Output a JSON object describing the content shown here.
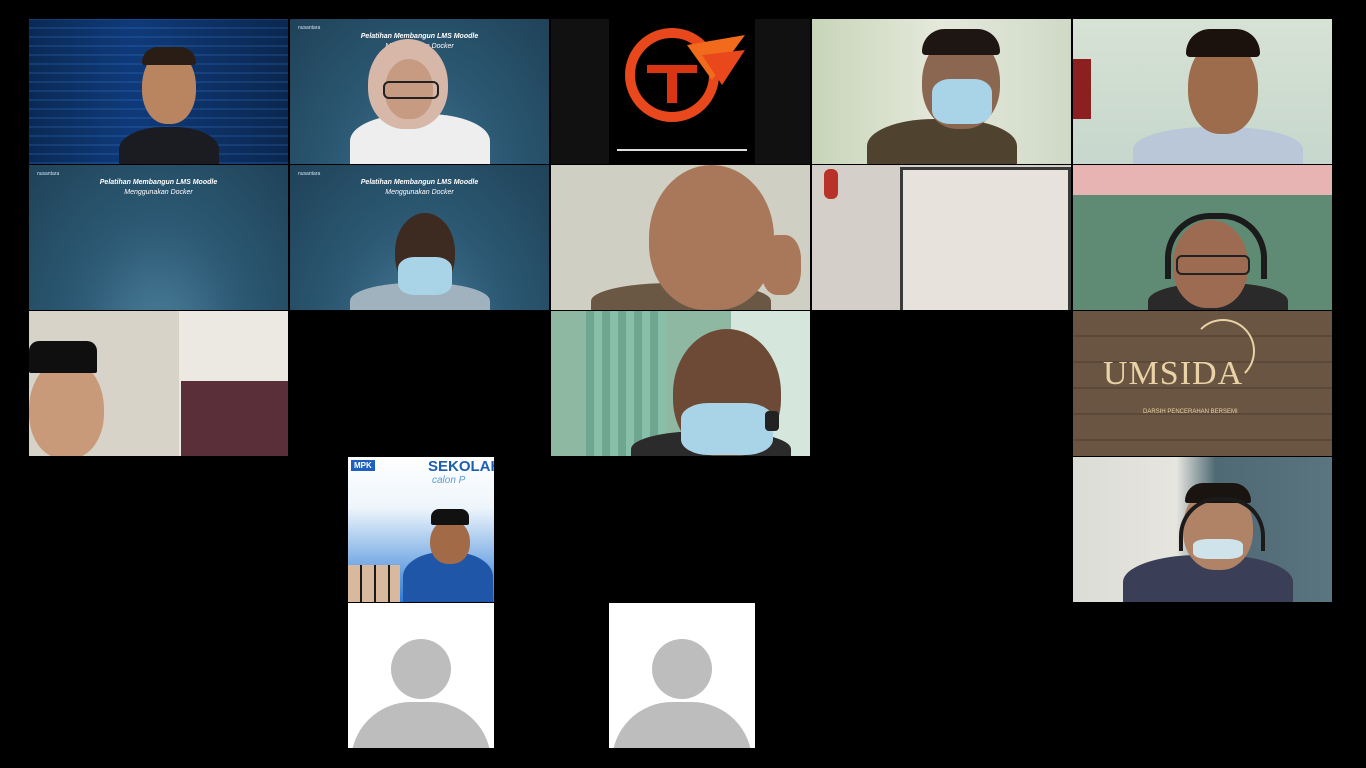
{
  "meeting": {
    "slide_title": "Pelatihan Membangun LMS Moodle",
    "slide_subtitle": "Menggunakan Docker",
    "slide_corner": "nusantara",
    "umsida_logo_text": "UMSIDA",
    "umsida_tagline": "DARSIH PENCERAHAN BERSEMI",
    "sekolah_title": "SEKOLAH",
    "sekolah_sub": "calon P",
    "mpk_badge": "MPK"
  },
  "icons": {
    "participant_avatar": "person-icon",
    "brand_logo": "t-logo-icon"
  },
  "colors": {
    "background": "#000000",
    "slide_blue": "#2d5a75",
    "logo_orange": "#e8481c",
    "placeholder": "#bdbdbd"
  }
}
